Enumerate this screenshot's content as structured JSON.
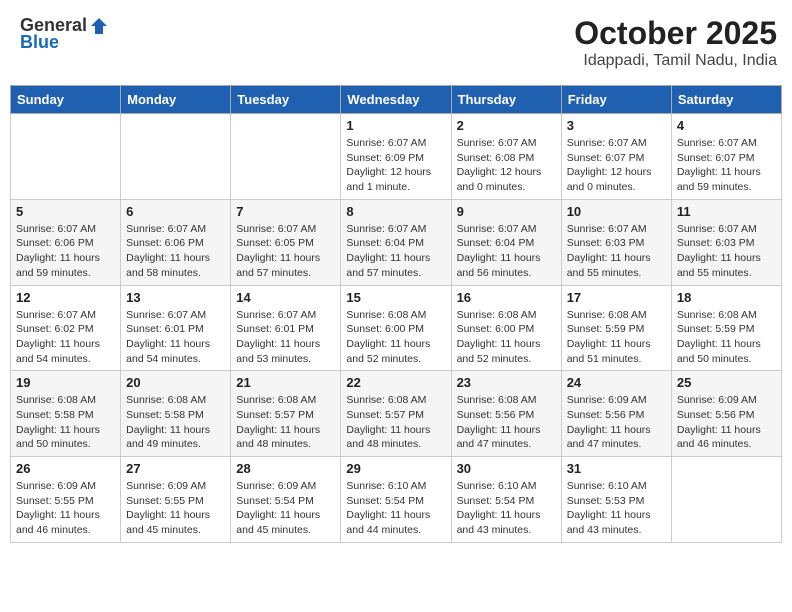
{
  "logo": {
    "text_general": "General",
    "text_blue": "Blue"
  },
  "title": "October 2025",
  "location": "Idappadi, Tamil Nadu, India",
  "weekdays": [
    "Sunday",
    "Monday",
    "Tuesday",
    "Wednesday",
    "Thursday",
    "Friday",
    "Saturday"
  ],
  "weeks": [
    [
      {
        "day": "",
        "info": ""
      },
      {
        "day": "",
        "info": ""
      },
      {
        "day": "",
        "info": ""
      },
      {
        "day": "1",
        "info": "Sunrise: 6:07 AM\nSunset: 6:09 PM\nDaylight: 12 hours and 1 minute."
      },
      {
        "day": "2",
        "info": "Sunrise: 6:07 AM\nSunset: 6:08 PM\nDaylight: 12 hours and 0 minutes."
      },
      {
        "day": "3",
        "info": "Sunrise: 6:07 AM\nSunset: 6:07 PM\nDaylight: 12 hours and 0 minutes."
      },
      {
        "day": "4",
        "info": "Sunrise: 6:07 AM\nSunset: 6:07 PM\nDaylight: 11 hours and 59 minutes."
      }
    ],
    [
      {
        "day": "5",
        "info": "Sunrise: 6:07 AM\nSunset: 6:06 PM\nDaylight: 11 hours and 59 minutes."
      },
      {
        "day": "6",
        "info": "Sunrise: 6:07 AM\nSunset: 6:06 PM\nDaylight: 11 hours and 58 minutes."
      },
      {
        "day": "7",
        "info": "Sunrise: 6:07 AM\nSunset: 6:05 PM\nDaylight: 11 hours and 57 minutes."
      },
      {
        "day": "8",
        "info": "Sunrise: 6:07 AM\nSunset: 6:04 PM\nDaylight: 11 hours and 57 minutes."
      },
      {
        "day": "9",
        "info": "Sunrise: 6:07 AM\nSunset: 6:04 PM\nDaylight: 11 hours and 56 minutes."
      },
      {
        "day": "10",
        "info": "Sunrise: 6:07 AM\nSunset: 6:03 PM\nDaylight: 11 hours and 55 minutes."
      },
      {
        "day": "11",
        "info": "Sunrise: 6:07 AM\nSunset: 6:03 PM\nDaylight: 11 hours and 55 minutes."
      }
    ],
    [
      {
        "day": "12",
        "info": "Sunrise: 6:07 AM\nSunset: 6:02 PM\nDaylight: 11 hours and 54 minutes."
      },
      {
        "day": "13",
        "info": "Sunrise: 6:07 AM\nSunset: 6:01 PM\nDaylight: 11 hours and 54 minutes."
      },
      {
        "day": "14",
        "info": "Sunrise: 6:07 AM\nSunset: 6:01 PM\nDaylight: 11 hours and 53 minutes."
      },
      {
        "day": "15",
        "info": "Sunrise: 6:08 AM\nSunset: 6:00 PM\nDaylight: 11 hours and 52 minutes."
      },
      {
        "day": "16",
        "info": "Sunrise: 6:08 AM\nSunset: 6:00 PM\nDaylight: 11 hours and 52 minutes."
      },
      {
        "day": "17",
        "info": "Sunrise: 6:08 AM\nSunset: 5:59 PM\nDaylight: 11 hours and 51 minutes."
      },
      {
        "day": "18",
        "info": "Sunrise: 6:08 AM\nSunset: 5:59 PM\nDaylight: 11 hours and 50 minutes."
      }
    ],
    [
      {
        "day": "19",
        "info": "Sunrise: 6:08 AM\nSunset: 5:58 PM\nDaylight: 11 hours and 50 minutes."
      },
      {
        "day": "20",
        "info": "Sunrise: 6:08 AM\nSunset: 5:58 PM\nDaylight: 11 hours and 49 minutes."
      },
      {
        "day": "21",
        "info": "Sunrise: 6:08 AM\nSunset: 5:57 PM\nDaylight: 11 hours and 48 minutes."
      },
      {
        "day": "22",
        "info": "Sunrise: 6:08 AM\nSunset: 5:57 PM\nDaylight: 11 hours and 48 minutes."
      },
      {
        "day": "23",
        "info": "Sunrise: 6:08 AM\nSunset: 5:56 PM\nDaylight: 11 hours and 47 minutes."
      },
      {
        "day": "24",
        "info": "Sunrise: 6:09 AM\nSunset: 5:56 PM\nDaylight: 11 hours and 47 minutes."
      },
      {
        "day": "25",
        "info": "Sunrise: 6:09 AM\nSunset: 5:56 PM\nDaylight: 11 hours and 46 minutes."
      }
    ],
    [
      {
        "day": "26",
        "info": "Sunrise: 6:09 AM\nSunset: 5:55 PM\nDaylight: 11 hours and 46 minutes."
      },
      {
        "day": "27",
        "info": "Sunrise: 6:09 AM\nSunset: 5:55 PM\nDaylight: 11 hours and 45 minutes."
      },
      {
        "day": "28",
        "info": "Sunrise: 6:09 AM\nSunset: 5:54 PM\nDaylight: 11 hours and 45 minutes."
      },
      {
        "day": "29",
        "info": "Sunrise: 6:10 AM\nSunset: 5:54 PM\nDaylight: 11 hours and 44 minutes."
      },
      {
        "day": "30",
        "info": "Sunrise: 6:10 AM\nSunset: 5:54 PM\nDaylight: 11 hours and 43 minutes."
      },
      {
        "day": "31",
        "info": "Sunrise: 6:10 AM\nSunset: 5:53 PM\nDaylight: 11 hours and 43 minutes."
      },
      {
        "day": "",
        "info": ""
      }
    ]
  ]
}
